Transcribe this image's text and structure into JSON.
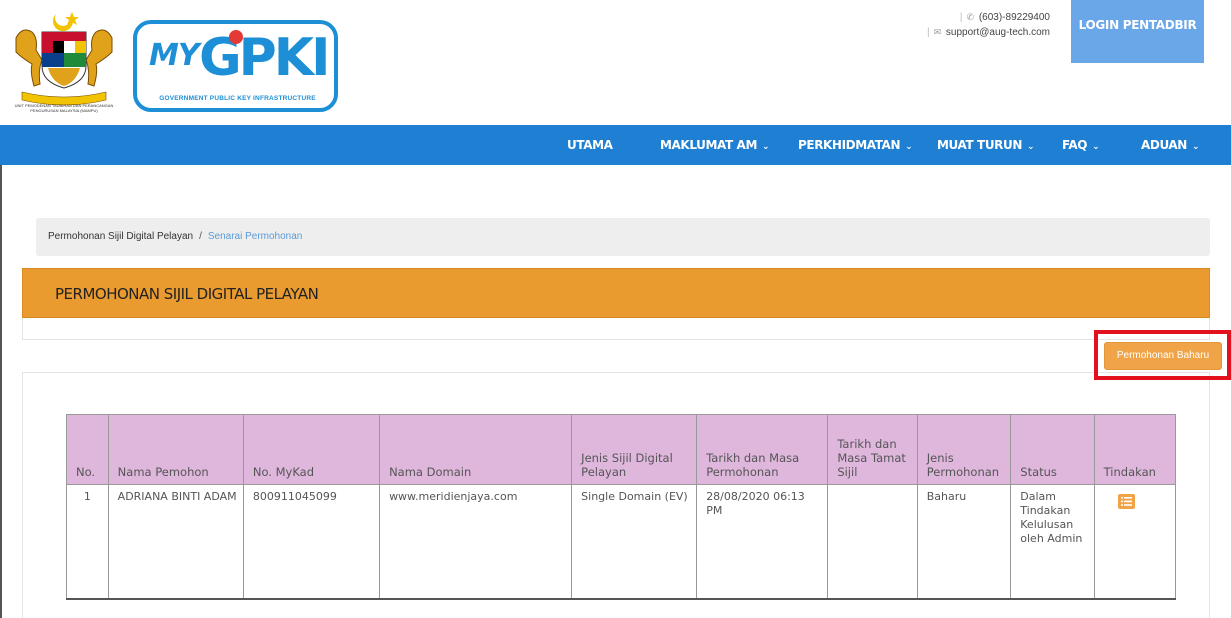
{
  "header": {
    "crest_caption": "UNIT PEMODENAN TADBIRAN DAN PERANCANGAN PENGURUSAN MALAYSIA (MAMPU)",
    "logo": {
      "my": "MY",
      "gpki": "GPKI",
      "subtitle": "GOVERNMENT PUBLIC KEY INFRASTRUCTURE"
    },
    "contact": {
      "phone": "(603)-89229400",
      "email": "support@aug-tech.com"
    },
    "login_label": "LOGIN PENTADBIR"
  },
  "nav": {
    "items": [
      {
        "label": "UTAMA",
        "has_dropdown": false
      },
      {
        "label": "MAKLUMAT AM",
        "has_dropdown": true
      },
      {
        "label": "PERKHIDMATAN",
        "has_dropdown": true
      },
      {
        "label": "MUAT TURUN",
        "has_dropdown": true
      },
      {
        "label": "FAQ",
        "has_dropdown": true
      },
      {
        "label": "ADUAN",
        "has_dropdown": true
      }
    ],
    "chevron": "⌄"
  },
  "breadcrumb": {
    "parent": "Permohonan Sijil Digital Pelayan",
    "divider": "/",
    "current": "Senarai Permohonan"
  },
  "panel": {
    "title": "PERMOHONAN SIJIL DIGITAL PELAYAN",
    "new_button": "Permohonan Baharu"
  },
  "table": {
    "headers": [
      "No.",
      "Nama Pemohon",
      "No. MyKad",
      "Nama Domain",
      "Jenis Sijil Digital Pelayan",
      "Tarikh dan Masa Permohonan",
      "Tarikh dan Masa Tamat Sijil",
      "Jenis Permohonan",
      "Status",
      "Tindakan"
    ],
    "rows": [
      {
        "no": "1",
        "nama": "ADRIANA BINTI ADAM",
        "mykad": "800911045099",
        "domain": "www.meridienjaya.com",
        "jenis_sijil": "Single Domain (EV)",
        "tarikh_mohon": "28/08/2020 06:13 PM",
        "tarikh_tamat": "",
        "jenis_permohonan": "Baharu",
        "status": "Dalam Tindakan Kelulusan oleh Admin"
      }
    ]
  },
  "colors": {
    "nav_bg": "#1f7fd3",
    "panel_head": "#ea9b2f",
    "button": "#f0a447",
    "table_header": "#dfb7dd",
    "highlight": "#e3101e"
  }
}
